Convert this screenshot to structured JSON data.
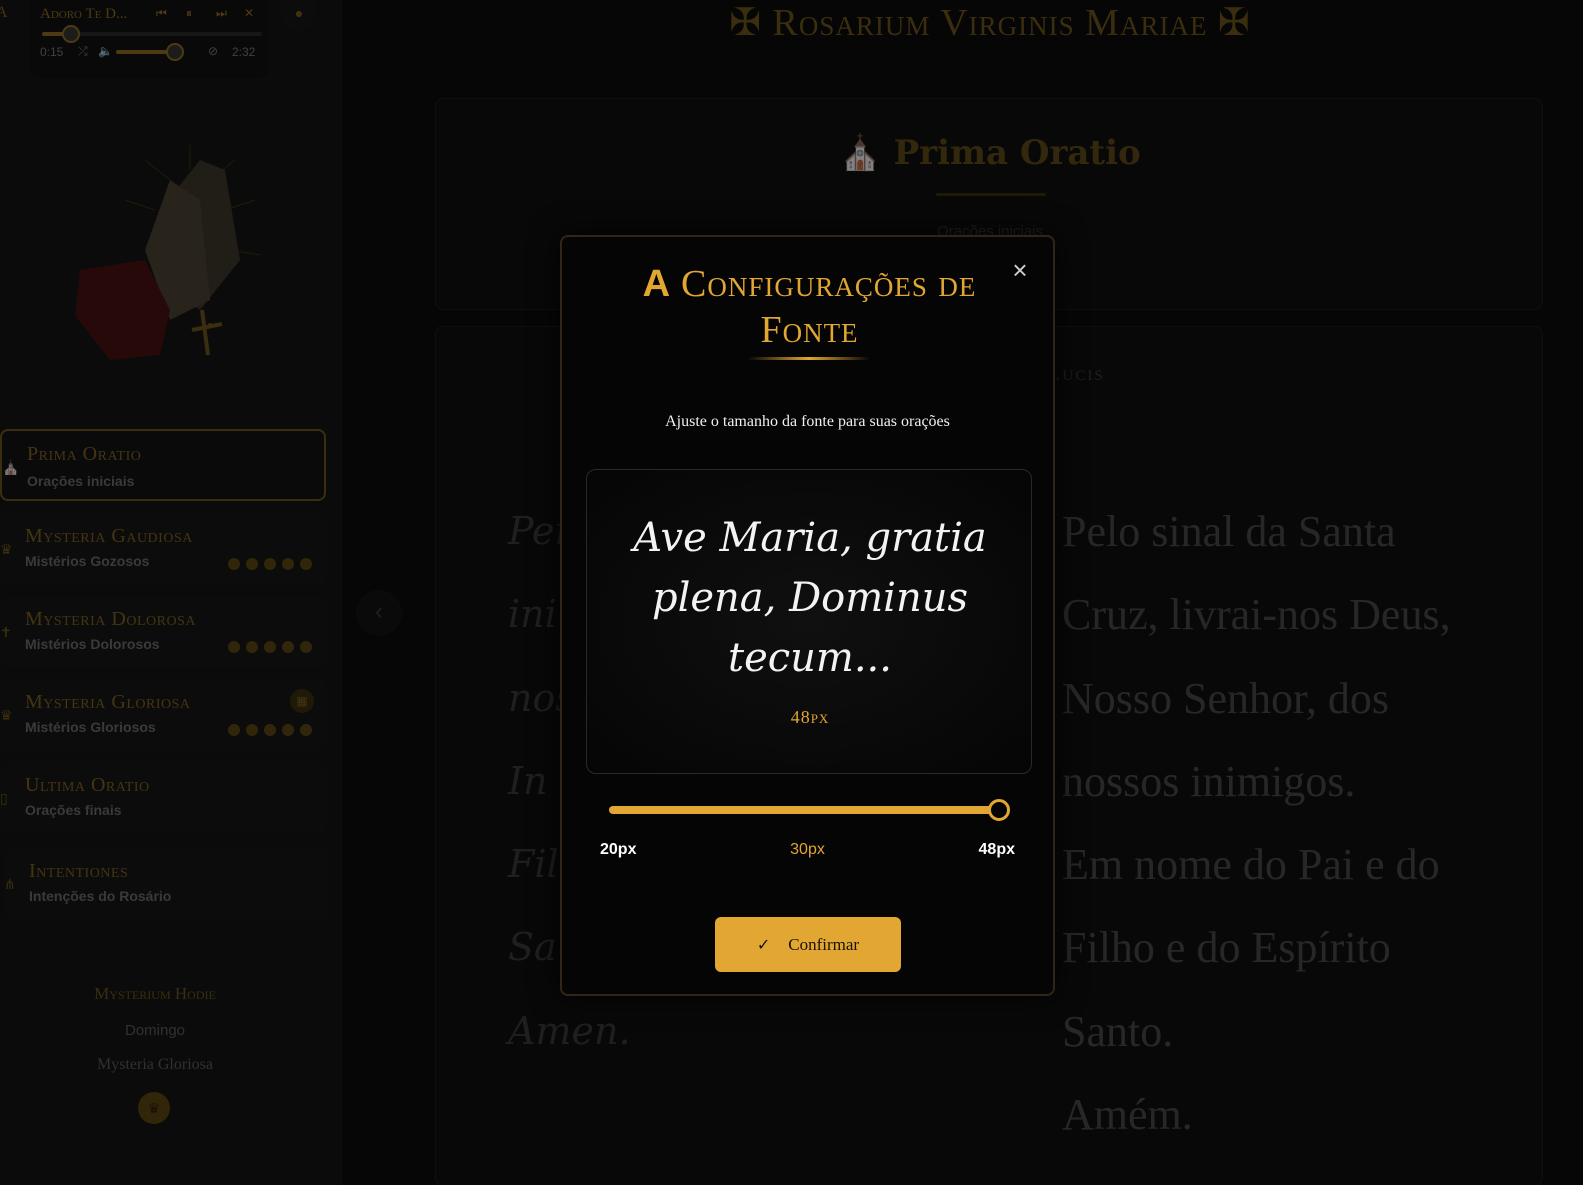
{
  "player": {
    "title": "Adoro Te D...",
    "elapsed": "0:15",
    "duration": "2:32",
    "progress_fraction": 0.1,
    "volume_fraction": 0.9
  },
  "header": {
    "title": "✠ Rosarium Virginis Mariae ✠"
  },
  "sidebar": {
    "items": [
      {
        "title": "Prima Oratio",
        "subtitle": "Orações iniciais",
        "icon": "altar-icon"
      },
      {
        "title": "Mysteria Gaudiosa",
        "subtitle": "Mistérios Gozosos",
        "icon": "crown-icon"
      },
      {
        "title": "Mysteria Dolorosa",
        "subtitle": "Mistérios Dolorosos",
        "icon": "cross-icon"
      },
      {
        "title": "Mysteria Gloriosa",
        "subtitle": "Mistérios Gloriosos",
        "icon": "crown-icon"
      },
      {
        "title": "Ultima Oratio",
        "subtitle": "Orações finais",
        "icon": "book-icon"
      },
      {
        "title": "Intentiones",
        "subtitle": "Intenções do Rosário",
        "icon": "candles-icon"
      }
    ],
    "hodie": {
      "title": "Mysterium Hodie",
      "day": "Domingo",
      "mystery": "Mysteria Gloriosa"
    }
  },
  "content": {
    "section_title": "Prima Oratio",
    "section_subtitle": "Orações iniciais",
    "prayer_heading": "...ucis",
    "latin_lines": [
      "Per",
      "ini",
      "nos",
      "In",
      "Fil",
      "Sa",
      "Amen."
    ],
    "portuguese_lines": [
      "Pelo sinal da Santa",
      "Cruz, livrai-nos Deus,",
      "Nosso Senhor, dos",
      "nossos inimigos.",
      "Em nome do Pai e do",
      "Filho e do Espírito",
      "Santo.",
      "Amém."
    ]
  },
  "modal": {
    "title_icon": "A",
    "title": "Configurações de Fonte",
    "description": "Ajuste o tamanho da fonte para suas orações",
    "preview_text": "Ave Maria, gratia plena, Dominus tecum...",
    "current_size": "48px",
    "slider": {
      "min": 20,
      "max": 48,
      "value": 48,
      "min_label": "20px",
      "mid_label": "30px",
      "max_label": "48px"
    },
    "confirm_label": "Confirmar",
    "close_label": "×"
  },
  "colors": {
    "accent": "#e2a632",
    "background": "#0b0b0b",
    "modal_bg": "#050505"
  }
}
